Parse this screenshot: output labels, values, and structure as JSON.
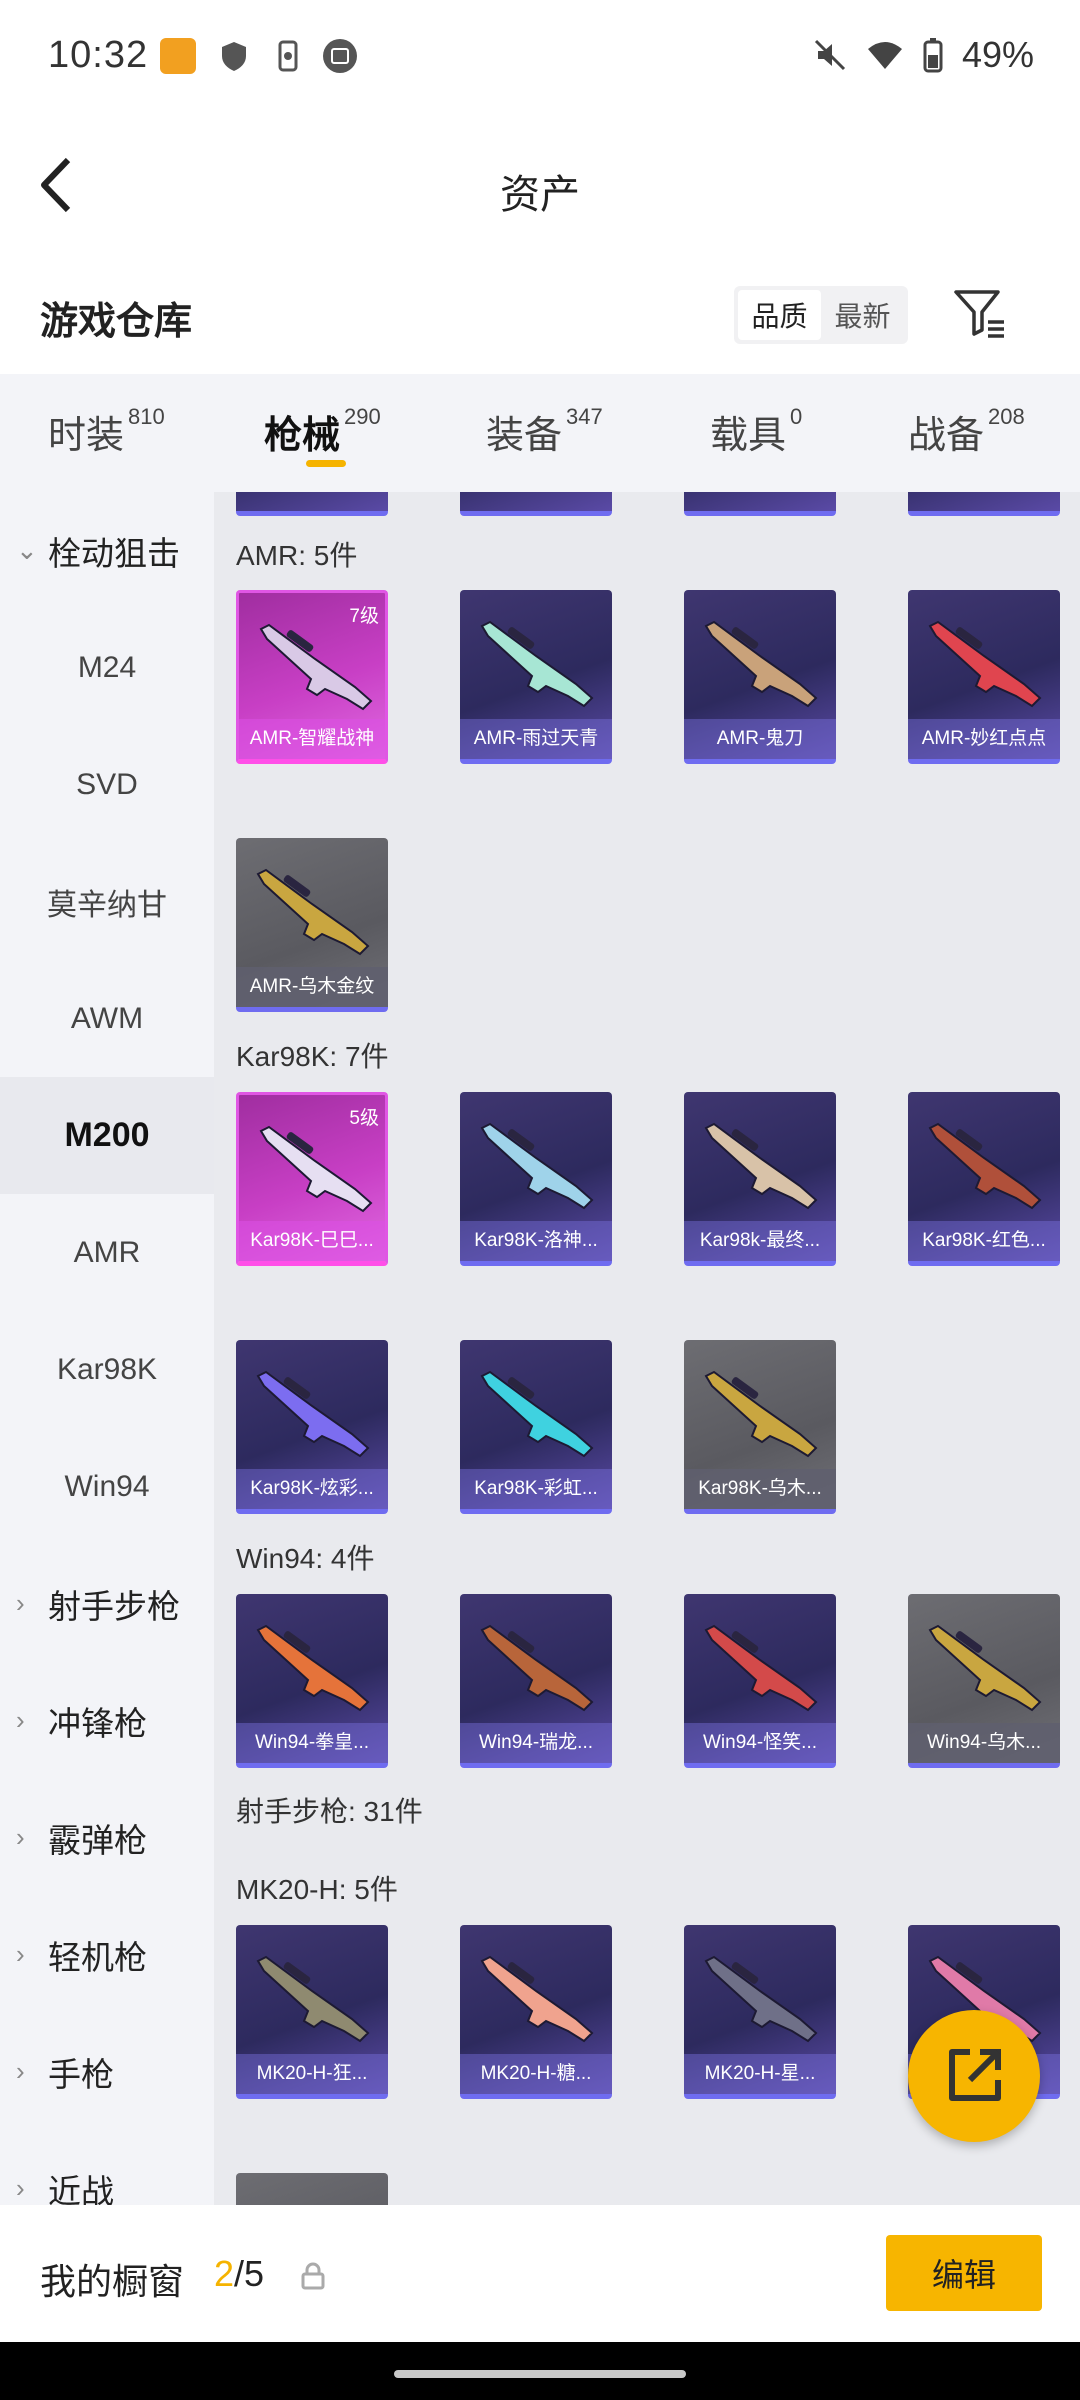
{
  "status_bar": {
    "time": "10:32",
    "battery": "49%"
  },
  "header": {
    "title": "资产"
  },
  "warehouse": {
    "title": "游戏仓库",
    "sort_options": [
      "品质",
      "最新"
    ],
    "sort_selected": "品质"
  },
  "tabs": [
    {
      "label": "时装",
      "count": "810"
    },
    {
      "label": "枪械",
      "count": "290"
    },
    {
      "label": "装备",
      "count": "347"
    },
    {
      "label": "载具",
      "count": "0"
    },
    {
      "label": "战备",
      "count": "208"
    }
  ],
  "sidebar": [
    {
      "label": "栓动狙击",
      "chevron": "⌄"
    },
    {
      "label": "M24"
    },
    {
      "label": "SVD"
    },
    {
      "label": "莫辛纳甘"
    },
    {
      "label": "AWM"
    },
    {
      "label": "M200"
    },
    {
      "label": "AMR"
    },
    {
      "label": "Kar98K"
    },
    {
      "label": "Win94"
    },
    {
      "label": "射手步枪",
      "chevron": "›"
    },
    {
      "label": "冲锋枪",
      "chevron": "›"
    },
    {
      "label": "霰弹枪",
      "chevron": "›"
    },
    {
      "label": "轻机枪",
      "chevron": "›"
    },
    {
      "label": "手枪",
      "chevron": "›"
    },
    {
      "label": "近战",
      "chevron": "›"
    }
  ],
  "sections": [
    {
      "title": "AMR: 5件"
    },
    {
      "title": "Kar98K: 7件"
    },
    {
      "title": "Win94: 4件"
    },
    {
      "title": "射手步枪: 31件"
    },
    {
      "title": "MK20-H: 5件"
    }
  ],
  "items": [
    {
      "name": "AMR-智耀战神",
      "level": "7级",
      "rarity": "legendary",
      "gun_color": "#d9c9e6"
    },
    {
      "name": "AMR-雨过天青",
      "rarity": "epic",
      "gun_color": "#a7e6d4"
    },
    {
      "name": "AMR-鬼刀",
      "rarity": "epic",
      "gun_color": "#c9a27a"
    },
    {
      "name": "AMR-妙红点点",
      "rarity": "epic",
      "gun_color": "#e0454f"
    },
    {
      "name": "AMR-乌木金纹",
      "rarity": "gray",
      "gun_color": "#c9a640"
    },
    {
      "name": "Kar98K-巳巳...",
      "level": "5级",
      "rarity": "legendary",
      "gun_color": "#e6dff2"
    },
    {
      "name": "Kar98K-洛神...",
      "rarity": "epic",
      "gun_color": "#9fd3ea"
    },
    {
      "name": "Kar98k-最终...",
      "rarity": "epic",
      "gun_color": "#d8c2a8"
    },
    {
      "name": "Kar98K-红色...",
      "rarity": "epic",
      "gun_color": "#b0503a"
    },
    {
      "name": "Kar98K-炫彩...",
      "rarity": "epic",
      "gun_color": "#7c6df0"
    },
    {
      "name": "Kar98K-彩虹...",
      "rarity": "epic",
      "gun_color": "#3fd2e0"
    },
    {
      "name": "Kar98K-乌木...",
      "rarity": "gray",
      "gun_color": "#c9a640"
    },
    {
      "name": "Win94-拳皇...",
      "rarity": "epic",
      "gun_color": "#e5733a"
    },
    {
      "name": "Win94-瑞龙...",
      "rarity": "epic",
      "gun_color": "#b8653a"
    },
    {
      "name": "Win94-怪笑...",
      "rarity": "epic",
      "gun_color": "#d34a4a"
    },
    {
      "name": "Win94-乌木...",
      "rarity": "gray",
      "gun_color": "#c9a640"
    },
    {
      "name": "MK20-H-狂...",
      "rarity": "epic",
      "gun_color": "#8f8a70"
    },
    {
      "name": "MK20-H-糖...",
      "rarity": "epic",
      "gun_color": "#f0a38e"
    },
    {
      "name": "MK20-H-星...",
      "rarity": "epic",
      "gun_color": "#6f7088"
    },
    {
      "name": "",
      "rarity": "epic",
      "gun_color": "#e07aa8"
    }
  ],
  "bottom": {
    "showcase_label": "我的橱窗",
    "current": "2",
    "separator": "/",
    "total": "5",
    "edit_label": "编辑"
  }
}
